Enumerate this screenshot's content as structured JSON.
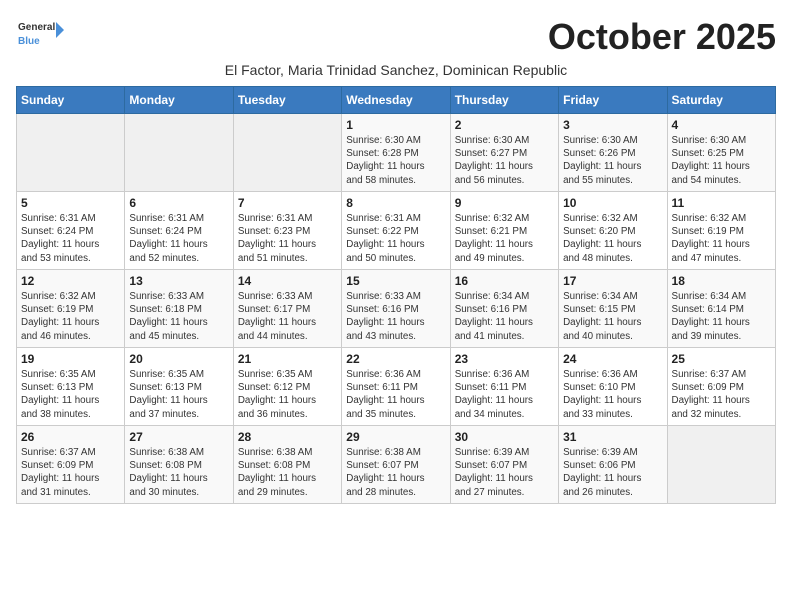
{
  "logo": {
    "line1": "General",
    "line2": "Blue"
  },
  "title": "October 2025",
  "subtitle": "El Factor, Maria Trinidad Sanchez, Dominican Republic",
  "days_header": [
    "Sunday",
    "Monday",
    "Tuesday",
    "Wednesday",
    "Thursday",
    "Friday",
    "Saturday"
  ],
  "weeks": [
    [
      {
        "day": "",
        "info": ""
      },
      {
        "day": "",
        "info": ""
      },
      {
        "day": "",
        "info": ""
      },
      {
        "day": "1",
        "info": "Sunrise: 6:30 AM\nSunset: 6:28 PM\nDaylight: 11 hours\nand 58 minutes."
      },
      {
        "day": "2",
        "info": "Sunrise: 6:30 AM\nSunset: 6:27 PM\nDaylight: 11 hours\nand 56 minutes."
      },
      {
        "day": "3",
        "info": "Sunrise: 6:30 AM\nSunset: 6:26 PM\nDaylight: 11 hours\nand 55 minutes."
      },
      {
        "day": "4",
        "info": "Sunrise: 6:30 AM\nSunset: 6:25 PM\nDaylight: 11 hours\nand 54 minutes."
      }
    ],
    [
      {
        "day": "5",
        "info": "Sunrise: 6:31 AM\nSunset: 6:24 PM\nDaylight: 11 hours\nand 53 minutes."
      },
      {
        "day": "6",
        "info": "Sunrise: 6:31 AM\nSunset: 6:24 PM\nDaylight: 11 hours\nand 52 minutes."
      },
      {
        "day": "7",
        "info": "Sunrise: 6:31 AM\nSunset: 6:23 PM\nDaylight: 11 hours\nand 51 minutes."
      },
      {
        "day": "8",
        "info": "Sunrise: 6:31 AM\nSunset: 6:22 PM\nDaylight: 11 hours\nand 50 minutes."
      },
      {
        "day": "9",
        "info": "Sunrise: 6:32 AM\nSunset: 6:21 PM\nDaylight: 11 hours\nand 49 minutes."
      },
      {
        "day": "10",
        "info": "Sunrise: 6:32 AM\nSunset: 6:20 PM\nDaylight: 11 hours\nand 48 minutes."
      },
      {
        "day": "11",
        "info": "Sunrise: 6:32 AM\nSunset: 6:19 PM\nDaylight: 11 hours\nand 47 minutes."
      }
    ],
    [
      {
        "day": "12",
        "info": "Sunrise: 6:32 AM\nSunset: 6:19 PM\nDaylight: 11 hours\nand 46 minutes."
      },
      {
        "day": "13",
        "info": "Sunrise: 6:33 AM\nSunset: 6:18 PM\nDaylight: 11 hours\nand 45 minutes."
      },
      {
        "day": "14",
        "info": "Sunrise: 6:33 AM\nSunset: 6:17 PM\nDaylight: 11 hours\nand 44 minutes."
      },
      {
        "day": "15",
        "info": "Sunrise: 6:33 AM\nSunset: 6:16 PM\nDaylight: 11 hours\nand 43 minutes."
      },
      {
        "day": "16",
        "info": "Sunrise: 6:34 AM\nSunset: 6:16 PM\nDaylight: 11 hours\nand 41 minutes."
      },
      {
        "day": "17",
        "info": "Sunrise: 6:34 AM\nSunset: 6:15 PM\nDaylight: 11 hours\nand 40 minutes."
      },
      {
        "day": "18",
        "info": "Sunrise: 6:34 AM\nSunset: 6:14 PM\nDaylight: 11 hours\nand 39 minutes."
      }
    ],
    [
      {
        "day": "19",
        "info": "Sunrise: 6:35 AM\nSunset: 6:13 PM\nDaylight: 11 hours\nand 38 minutes."
      },
      {
        "day": "20",
        "info": "Sunrise: 6:35 AM\nSunset: 6:13 PM\nDaylight: 11 hours\nand 37 minutes."
      },
      {
        "day": "21",
        "info": "Sunrise: 6:35 AM\nSunset: 6:12 PM\nDaylight: 11 hours\nand 36 minutes."
      },
      {
        "day": "22",
        "info": "Sunrise: 6:36 AM\nSunset: 6:11 PM\nDaylight: 11 hours\nand 35 minutes."
      },
      {
        "day": "23",
        "info": "Sunrise: 6:36 AM\nSunset: 6:11 PM\nDaylight: 11 hours\nand 34 minutes."
      },
      {
        "day": "24",
        "info": "Sunrise: 6:36 AM\nSunset: 6:10 PM\nDaylight: 11 hours\nand 33 minutes."
      },
      {
        "day": "25",
        "info": "Sunrise: 6:37 AM\nSunset: 6:09 PM\nDaylight: 11 hours\nand 32 minutes."
      }
    ],
    [
      {
        "day": "26",
        "info": "Sunrise: 6:37 AM\nSunset: 6:09 PM\nDaylight: 11 hours\nand 31 minutes."
      },
      {
        "day": "27",
        "info": "Sunrise: 6:38 AM\nSunset: 6:08 PM\nDaylight: 11 hours\nand 30 minutes."
      },
      {
        "day": "28",
        "info": "Sunrise: 6:38 AM\nSunset: 6:08 PM\nDaylight: 11 hours\nand 29 minutes."
      },
      {
        "day": "29",
        "info": "Sunrise: 6:38 AM\nSunset: 6:07 PM\nDaylight: 11 hours\nand 28 minutes."
      },
      {
        "day": "30",
        "info": "Sunrise: 6:39 AM\nSunset: 6:07 PM\nDaylight: 11 hours\nand 27 minutes."
      },
      {
        "day": "31",
        "info": "Sunrise: 6:39 AM\nSunset: 6:06 PM\nDaylight: 11 hours\nand 26 minutes."
      },
      {
        "day": "",
        "info": ""
      }
    ]
  ]
}
